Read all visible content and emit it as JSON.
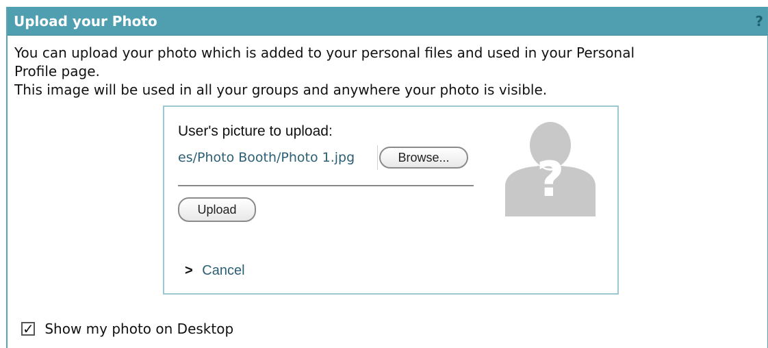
{
  "panel": {
    "title": "Upload your Photo",
    "help_label": "?"
  },
  "description": {
    "line1": "You can upload your photo which is added to your personal files and used in your Personal",
    "line2": "Profile page.",
    "line3": "This image will be used in all your groups and anywhere your photo is visible."
  },
  "upload_form": {
    "label": "User's picture to upload:",
    "file_path": "es/Photo Booth/Photo 1.jpg",
    "browse_label": "Browse...",
    "upload_label": "Upload",
    "cancel_arrow": ">",
    "cancel_label": "Cancel",
    "avatar_icon": "unknown-user-avatar-icon"
  },
  "options": {
    "show_on_desktop_label": "Show my photo on Desktop",
    "show_on_desktop_checked": true,
    "checkmark": "✓"
  },
  "colors": {
    "header_bg": "#4f9fb0",
    "header_text": "#ffffff",
    "link": "#2b5f74",
    "border": "#9cc6d2",
    "avatar": "#c8c8c8"
  }
}
